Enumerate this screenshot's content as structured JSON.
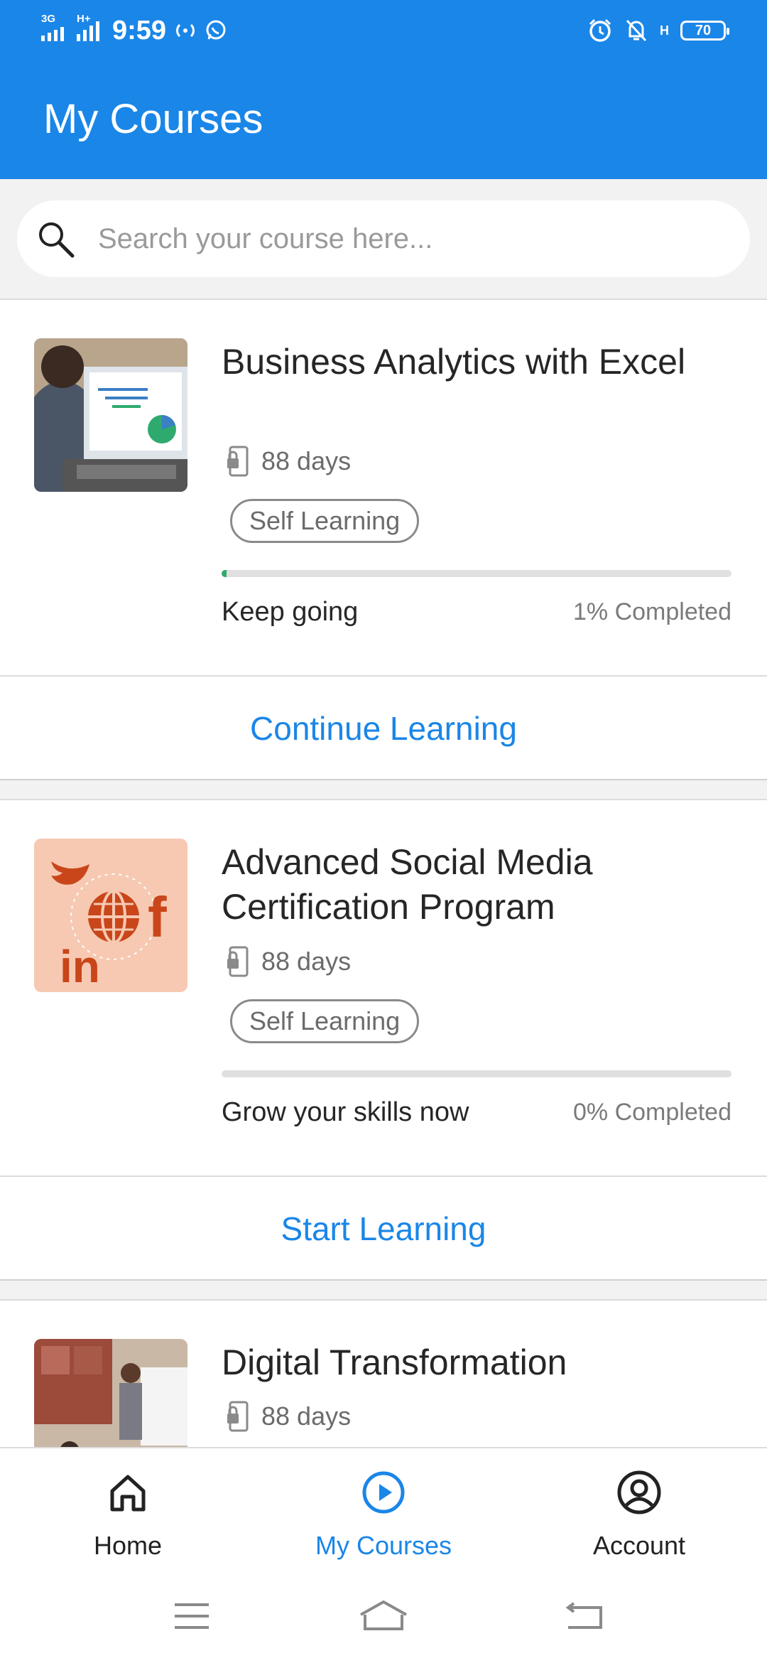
{
  "status_bar": {
    "time": "9:59",
    "network_1": "3G",
    "network_2": "H+",
    "network_3": "H",
    "battery": "70",
    "icons": [
      "signal-icon",
      "signal-icon",
      "hotspot-icon",
      "whatsapp-icon",
      "alarm-icon",
      "bell-off-icon",
      "battery-icon"
    ]
  },
  "header": {
    "title": "My Courses"
  },
  "search": {
    "placeholder": "Search your course here..."
  },
  "courses": [
    {
      "title": "Business Analytics with Excel",
      "days": "88 days",
      "type": "Self Learning",
      "progress": 0.01,
      "message": "Keep going",
      "completed": "1% Completed",
      "action": "Continue Learning"
    },
    {
      "title": "Advanced Social Media Certification Program",
      "days": "88 days",
      "type": "Self Learning",
      "progress": 0.0,
      "message": "Grow your skills now",
      "completed": "0% Completed",
      "action": "Start Learning"
    },
    {
      "title": "Digital Transformation",
      "days": "88 days"
    }
  ],
  "bottom_nav": {
    "items": [
      {
        "label": "Home",
        "icon": "home-icon",
        "active": false
      },
      {
        "label": "My Courses",
        "icon": "play-circle-icon",
        "active": true
      },
      {
        "label": "Account",
        "icon": "account-icon",
        "active": false
      }
    ]
  },
  "colors": {
    "primary": "#1a86e8",
    "progress": "#2eaa6e",
    "social_thumb_bg": "#f7c9b2",
    "social_thumb_fg": "#c9461a"
  }
}
